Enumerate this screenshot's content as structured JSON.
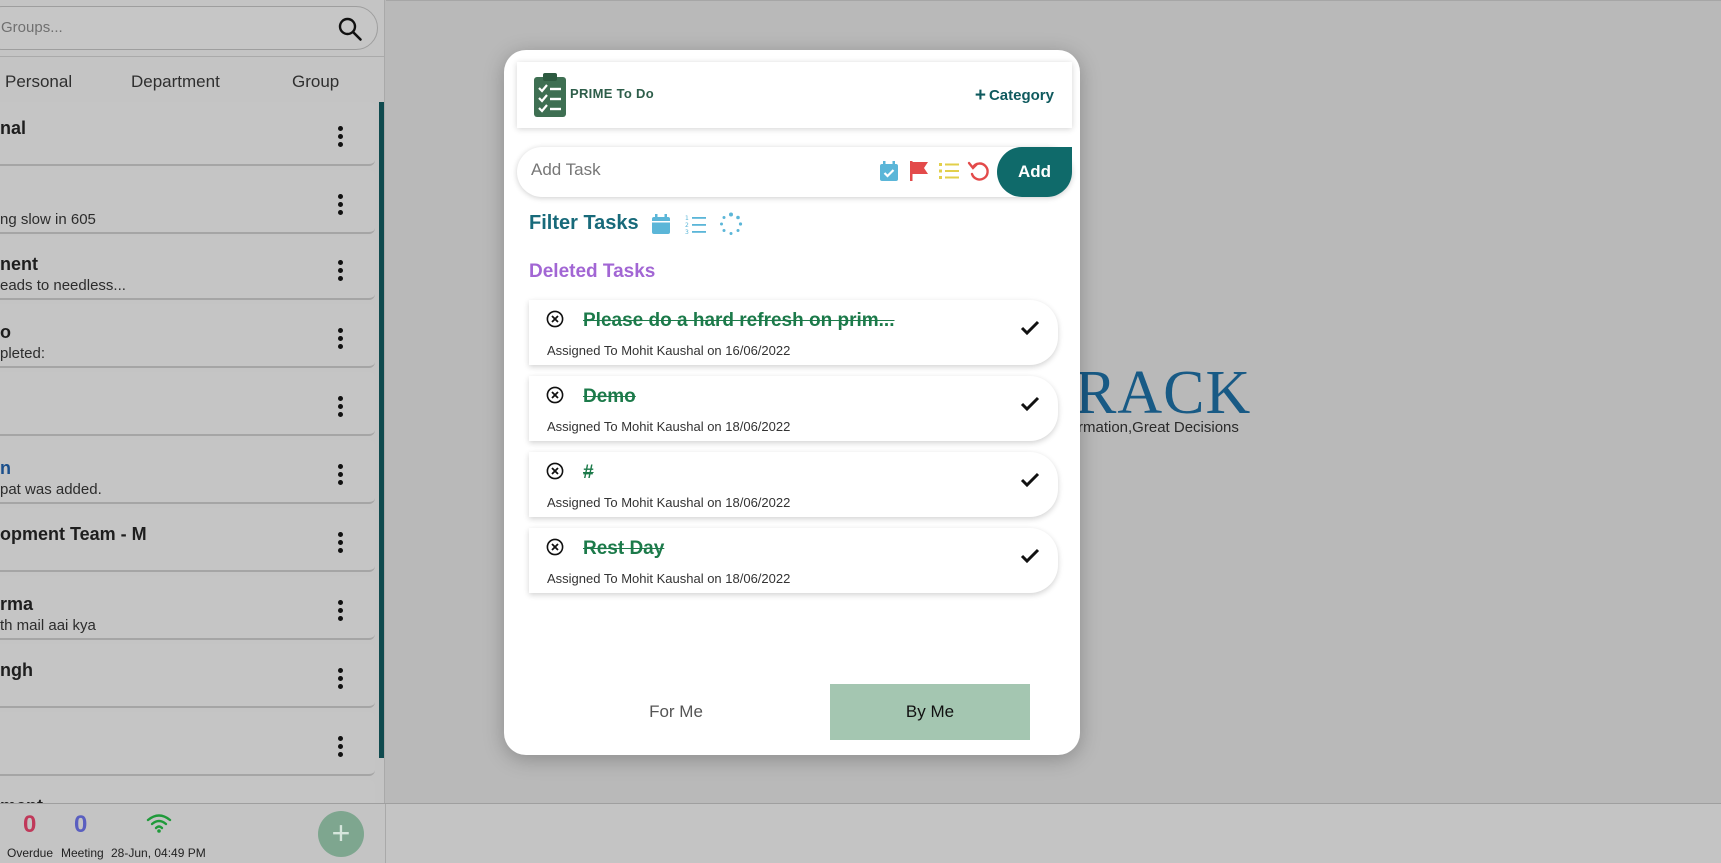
{
  "sidebar": {
    "search": {
      "placeholder": "Groups..."
    },
    "tabs": [
      "Personal",
      "Department",
      "Group"
    ],
    "items": [
      {
        "title": "nal",
        "subtitle": ""
      },
      {
        "title": "",
        "subtitle": "ng slow in 605"
      },
      {
        "title": "nent",
        "subtitle": "eads to needless..."
      },
      {
        "title": "o",
        "subtitle": "pleted:"
      },
      {
        "title": "",
        "subtitle": ""
      },
      {
        "title": "n",
        "subtitle": "pat was added."
      },
      {
        "title": "opment Team - M",
        "subtitle": ""
      },
      {
        "title": "rma",
        "subtitle": "th mail aai kya"
      },
      {
        "title": "ngh",
        "subtitle": ""
      },
      {
        "title": "",
        "subtitle": ""
      },
      {
        "title": "ment",
        "subtitle": ""
      }
    ]
  },
  "status_bar": {
    "overdue_count": "0",
    "overdue_label": "Overdue",
    "meeting_count": "0",
    "meeting_label": "Meeting",
    "datetime": "28-Jun, 04:49 PM",
    "fab_label": "+",
    "overdue_color": "#c0395a",
    "meeting_color": "#5a5fc0"
  },
  "background_logo": {
    "text": "RACK",
    "tagline": "rmation,Great Decisions"
  },
  "modal": {
    "app_title": "PRIME To Do",
    "add_category_label": "Category",
    "task_input": {
      "placeholder": "Add Task",
      "value": ""
    },
    "add_button_label": "Add",
    "input_icons": [
      "calendar-check-icon",
      "flag-icon",
      "list-icon",
      "undo-icon"
    ],
    "filter_label": "Filter Tasks",
    "filter_icons": [
      "calendar-icon",
      "ordered-list-icon",
      "loading-spinner-icon"
    ],
    "section_heading": "Deleted Tasks",
    "tasks": [
      {
        "title": "Please do a hard refresh on prim...",
        "meta": "Assigned To Mohit Kaushal on 16/06/2022"
      },
      {
        "title": "Demo",
        "meta": "Assigned To Mohit Kaushal on 18/06/2022"
      },
      {
        "title": "#",
        "meta": "Assigned To Mohit Kaushal on 18/06/2022"
      },
      {
        "title": "Rest Day",
        "meta": "Assigned To Mohit Kaushal on 18/06/2022"
      }
    ],
    "footer_tabs": {
      "for_me": "For Me",
      "by_me": "By Me"
    },
    "colors": {
      "accent": "#0f6a6a",
      "deleted_heading": "#a266d4",
      "task_title": "#1c7a4a",
      "active_tab": "#a4c6b1"
    }
  }
}
